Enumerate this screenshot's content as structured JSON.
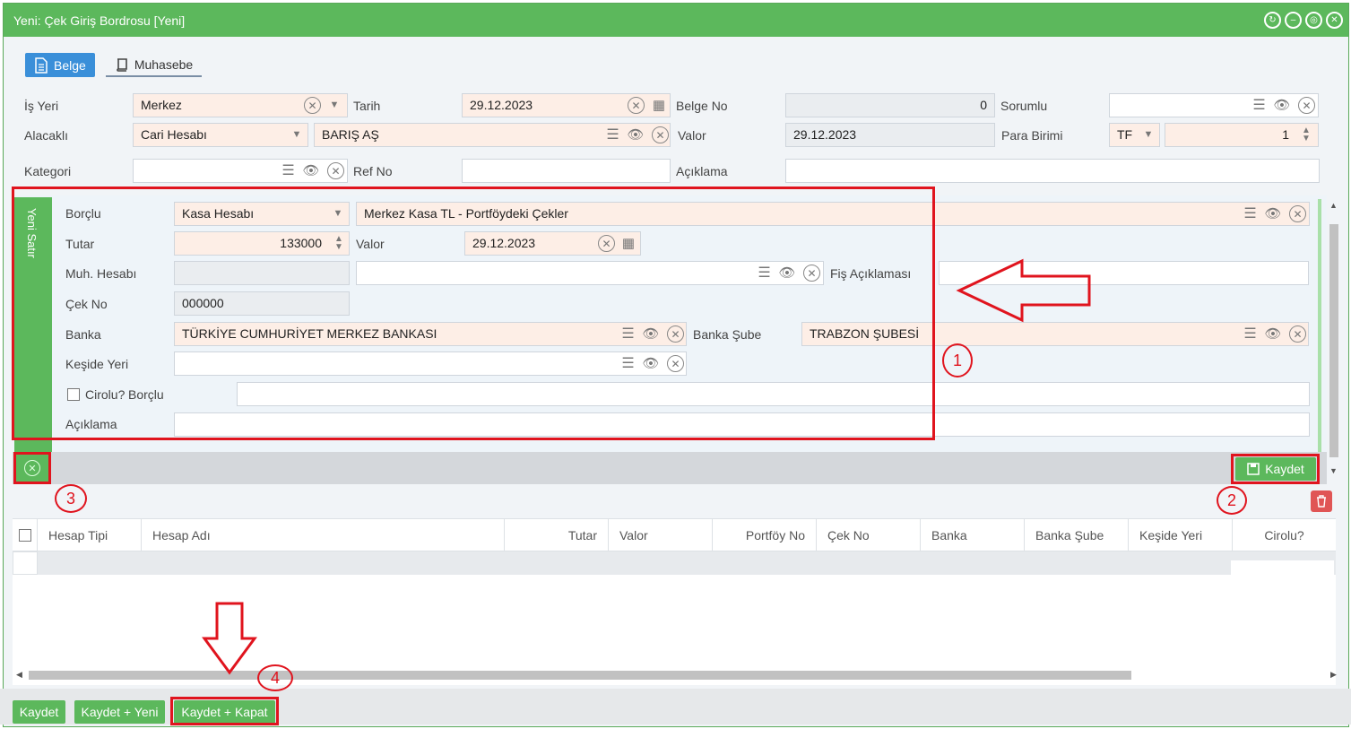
{
  "window": {
    "title": "Yeni: Çek Giriş Bordrosu [Yeni]"
  },
  "tabs": [
    {
      "label": "Belge"
    },
    {
      "label": "Muhasebe"
    }
  ],
  "header": {
    "is_yeri": {
      "label": "İş Yeri",
      "value": "Merkez"
    },
    "tarih": {
      "label": "Tarih",
      "value": "29.12.2023"
    },
    "belge_no": {
      "label": "Belge No",
      "value": "0"
    },
    "sorumlu": {
      "label": "Sorumlu",
      "value": ""
    },
    "alacakli": {
      "label": "Alacaklı",
      "type": "Cari Hesabı",
      "value": "BARIŞ AŞ"
    },
    "valor": {
      "label": "Valor",
      "value": "29.12.2023"
    },
    "para_birimi": {
      "label": "Para Birimi",
      "currency": "TF",
      "rate": "1"
    },
    "kategori": {
      "label": "Kategori",
      "value": ""
    },
    "ref_no": {
      "label": "Ref No",
      "value": ""
    },
    "aciklama": {
      "label": "Açıklama",
      "value": ""
    }
  },
  "line": {
    "side_label": "Yeni Satır",
    "borclu": {
      "label": "Borçlu",
      "type": "Kasa Hesabı",
      "value": "Merkez Kasa TL - Portföydeki Çekler"
    },
    "tutar": {
      "label": "Tutar",
      "value": "133000"
    },
    "valor": {
      "label": "Valor",
      "value": "29.12.2023"
    },
    "muh_hesabi": {
      "label": "Muh. Hesabı",
      "value": ""
    },
    "fis_aciklamasi": {
      "label": "Fiş Açıklaması",
      "value": ""
    },
    "cek_no": {
      "label": "Çek No",
      "value": "000000"
    },
    "banka": {
      "label": "Banka",
      "value": "TÜRKİYE CUMHURİYET MERKEZ BANKASI"
    },
    "banka_sube": {
      "label": "Banka Şube",
      "value": "TRABZON ŞUBESİ"
    },
    "keside_yeri": {
      "label": "Keşide Yeri",
      "value": ""
    },
    "cirolu": {
      "label": "Cirolu?",
      "borclu_label": "Borçlu"
    },
    "aciklama": {
      "label": "Açıklama",
      "value": ""
    },
    "save_label": "Kaydet"
  },
  "grid": {
    "columns": [
      "Hesap Tipi",
      "Hesap Adı",
      "Tutar",
      "Valor",
      "Portföy No",
      "Çek No",
      "Banka",
      "Banka Şube",
      "Keşide Yeri",
      "Cirolu?"
    ]
  },
  "annotations": [
    "1",
    "2",
    "3",
    "4"
  ],
  "footer": {
    "save": "Kaydet",
    "save_new": "Kaydet + Yeni",
    "save_close": "Kaydet + Kapat"
  },
  "colors": {
    "green": "#5cb85c",
    "blue": "#3a8fd9",
    "annotation_red": "#e0141e",
    "required_field": "#fdeee6"
  }
}
